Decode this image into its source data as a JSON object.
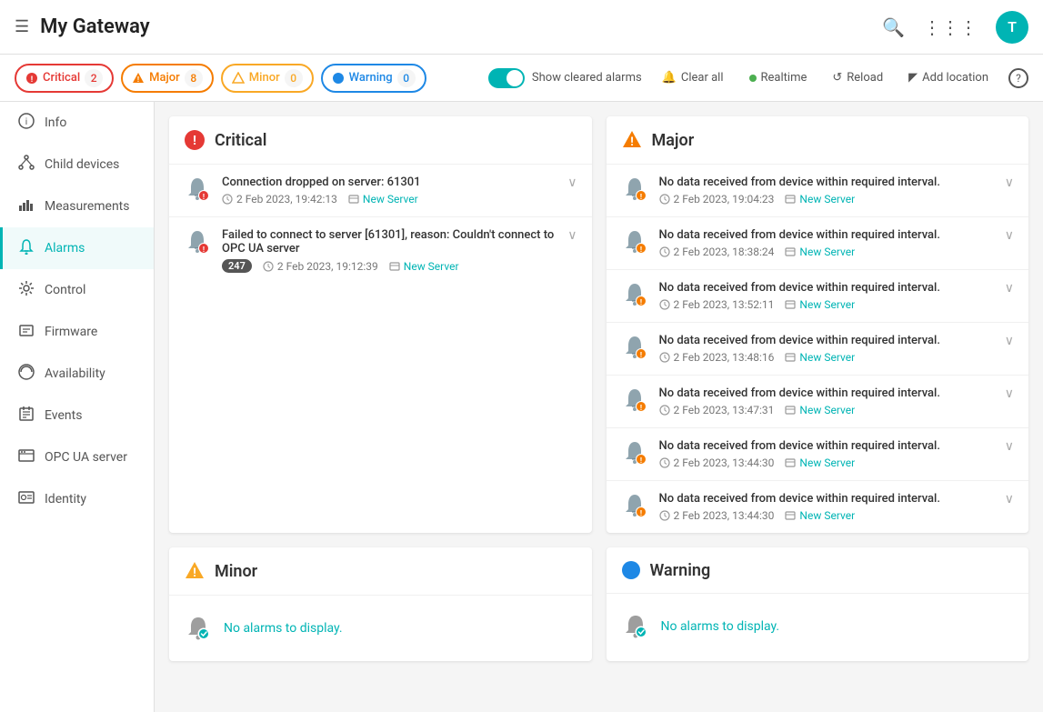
{
  "header": {
    "title": "My Gateway",
    "avatar_letter": "T"
  },
  "filter_bar": {
    "chips": [
      {
        "id": "critical",
        "label": "Critical",
        "count": "2",
        "type": "critical"
      },
      {
        "id": "major",
        "label": "Major",
        "count": "8",
        "type": "major"
      },
      {
        "id": "minor",
        "label": "Minor",
        "count": "0",
        "type": "minor"
      },
      {
        "id": "warning",
        "label": "Warning",
        "count": "0",
        "type": "warning"
      }
    ],
    "show_cleared_label": "Show cleared alarms",
    "clear_all_label": "Clear all",
    "realtime_label": "Realtime",
    "reload_label": "Reload",
    "add_location_label": "Add location"
  },
  "sidebar": {
    "items": [
      {
        "id": "info",
        "label": "Info",
        "icon": "ℹ"
      },
      {
        "id": "child-devices",
        "label": "Child devices",
        "icon": "⑂"
      },
      {
        "id": "measurements",
        "label": "Measurements",
        "icon": "📊"
      },
      {
        "id": "alarms",
        "label": "Alarms",
        "icon": "🔔",
        "active": true
      },
      {
        "id": "control",
        "label": "Control",
        "icon": "⚙"
      },
      {
        "id": "firmware",
        "label": "Firmware",
        "icon": "📦"
      },
      {
        "id": "availability",
        "label": "Availability",
        "icon": "📶"
      },
      {
        "id": "events",
        "label": "Events",
        "icon": "📋"
      },
      {
        "id": "opc-ua-server",
        "label": "OPC UA server",
        "icon": "🖥"
      },
      {
        "id": "identity",
        "label": "Identity",
        "icon": "🪪"
      }
    ]
  },
  "panels": {
    "critical": {
      "title": "Critical",
      "alarms": [
        {
          "id": "c1",
          "title": "Connection dropped on server: 61301",
          "time": "2 Feb 2023, 19:42:13",
          "source": "New Server",
          "count": null
        },
        {
          "id": "c2",
          "title": "Failed to connect to server [61301], reason: Couldn't connect to OPC UA server",
          "time": "2 Feb 2023, 19:12:39",
          "source": "New Server",
          "count": "247"
        }
      ]
    },
    "major": {
      "title": "Major",
      "alarms": [
        {
          "id": "m1",
          "title": "No data received from device within required interval.",
          "time": "2 Feb 2023, 19:04:23",
          "source": "New Server"
        },
        {
          "id": "m2",
          "title": "No data received from device within required interval.",
          "time": "2 Feb 2023, 18:38:24",
          "source": "New Server"
        },
        {
          "id": "m3",
          "title": "No data received from device within required interval.",
          "time": "2 Feb 2023, 13:52:11",
          "source": "New Server"
        },
        {
          "id": "m4",
          "title": "No data received from device within required interval.",
          "time": "2 Feb 2023, 13:48:16",
          "source": "New Server"
        },
        {
          "id": "m5",
          "title": "No data received from device within required interval.",
          "time": "2 Feb 2023, 13:47:31",
          "source": "New Server"
        },
        {
          "id": "m6",
          "title": "No data received from device within required interval.",
          "time": "2 Feb 2023, 13:44:30",
          "source": "New Server"
        },
        {
          "id": "m7",
          "title": "No data received from device within required interval.",
          "time": "2 Feb 2023, 13:44:30",
          "source": "New Server"
        }
      ]
    },
    "minor": {
      "title": "Minor",
      "no_alarms_text": "No alarms to display."
    },
    "warning": {
      "title": "Warning",
      "no_alarms_text": "No alarms to display."
    }
  }
}
